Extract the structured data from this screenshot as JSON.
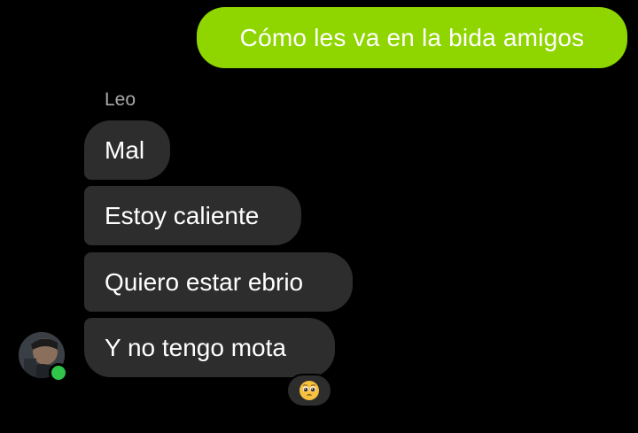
{
  "messages": {
    "outgoing": [
      {
        "text": "Cómo les va en la bida amigos"
      }
    ],
    "incoming_group": {
      "sender": "Leo",
      "items": [
        {
          "text": "Mal"
        },
        {
          "text": "Estoy caliente"
        },
        {
          "text": "Quiero estar ebrio"
        },
        {
          "text": "Y no tengo mota"
        }
      ],
      "reaction_icon": "pleading-face-emoji",
      "avatar_icon": "profile-photo",
      "online_status": "online"
    }
  },
  "colors": {
    "background": "#000000",
    "outgoing_bubble": "#8fd600",
    "incoming_bubble": "#2d2d2d",
    "online_dot": "#2fc44a",
    "sender_name": "#a9a9a9"
  }
}
